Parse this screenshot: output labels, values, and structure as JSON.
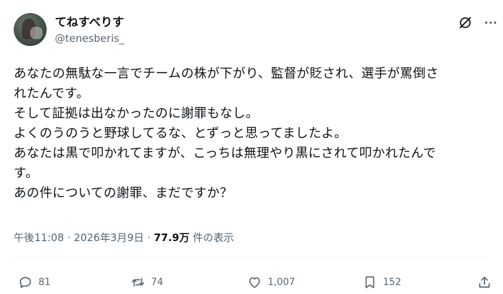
{
  "user": {
    "display_name": "てねすべりす",
    "handle": "@tenesberis_"
  },
  "tweet": {
    "text": "あなたの無駄な一言でチームの株が下がり、監督が貶され、選手が罵倒さ\nれたんです。\nそして証拠は出なかったのに謝罪もなし。\nよくのうのうと野球してるな、とずっと思ってましたよ。\nあなたは黒で叩かれてますが、こっちは無理やり黒にされて叩かれたんで\nす。\nあの件についての謝罪、まだですか？"
  },
  "meta": {
    "time": "午後11:08",
    "separator": " · ",
    "date": "2026年3月9日",
    "views": "77.9万",
    "views_label": " 件の表示"
  },
  "actions": {
    "replies": "81",
    "reposts": "74",
    "likes": "1,007",
    "bookmarks": "152"
  },
  "icons": {
    "grok": "grok-icon",
    "more": "more-icon",
    "reply": "reply-icon",
    "repost": "repost-icon",
    "like": "heart-icon",
    "bookmark": "bookmark-icon",
    "share": "share-icon"
  },
  "colors": {
    "text": "#0f1419",
    "secondary": "#536471",
    "divider": "#eff3f4"
  }
}
